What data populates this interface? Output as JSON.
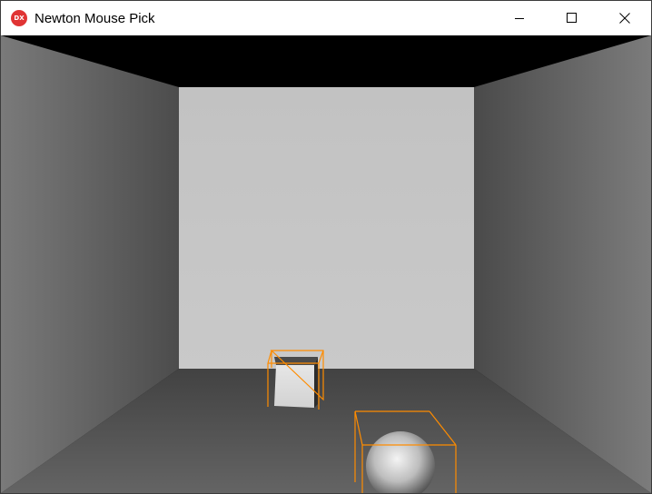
{
  "window": {
    "title": "Newton Mouse Pick",
    "icon_text": "DX",
    "icon_name": "directx-app-icon",
    "controls": [
      {
        "name": "minimize-button",
        "icon": "minimize-icon"
      },
      {
        "name": "maximize-button",
        "icon": "maximize-icon"
      },
      {
        "name": "close-button",
        "icon": "close-icon"
      }
    ]
  },
  "scene": {
    "objects": [
      {
        "name": "cube",
        "selection_box_color": "#ff8c00"
      },
      {
        "name": "sphere",
        "selection_box_color": "#ff8c00"
      }
    ]
  },
  "colors": {
    "ceiling": "#000000",
    "back_wall": "#c0c0c0",
    "floor": "#555555",
    "side_wall": "#6e6e6e",
    "bounding_box": "#ff8c00"
  }
}
